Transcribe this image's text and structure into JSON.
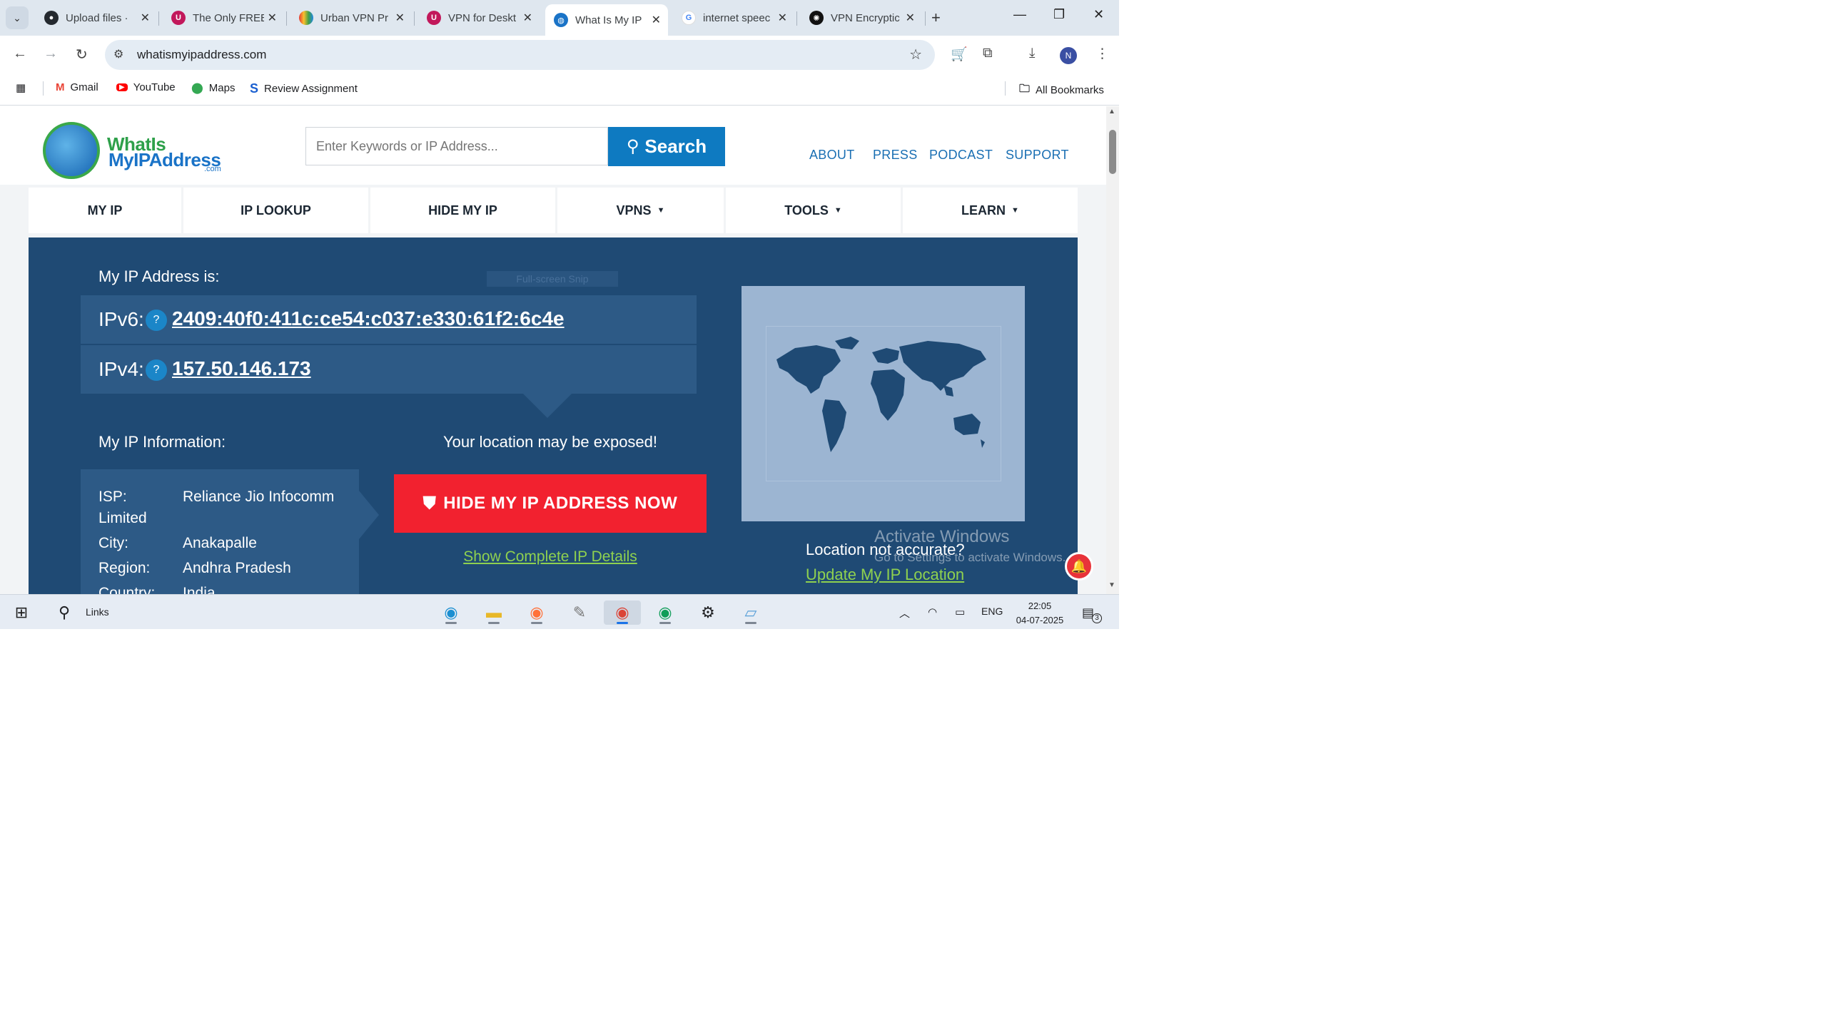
{
  "browser": {
    "tabs": [
      {
        "title": "Upload files · ",
        "icon": "github-icon"
      },
      {
        "title": "The Only FREE",
        "icon": "urban-vpn-icon"
      },
      {
        "title": "Urban VPN Pr",
        "icon": "rainbow-icon"
      },
      {
        "title": "VPN for Deskt",
        "icon": "urban-vpn-icon"
      },
      {
        "title": "What Is My IP",
        "icon": "globe-icon",
        "active": true
      },
      {
        "title": "internet speec",
        "icon": "google-icon"
      },
      {
        "title": "VPN Encryptic",
        "icon": "openai-icon"
      }
    ],
    "url": "whatismyipaddress.com",
    "profile_initial": "N",
    "bookmarks": [
      {
        "label": "Gmail",
        "icon": "gmail-icon"
      },
      {
        "label": "YouTube",
        "icon": "youtube-icon"
      },
      {
        "label": "Maps",
        "icon": "maps-icon"
      },
      {
        "label": "Review Assignment",
        "icon": "s-icon"
      }
    ],
    "all_bookmarks": "All Bookmarks"
  },
  "site": {
    "logo_line1": "WhatIs",
    "logo_line2": "MyIPAddress",
    "logo_com": ".com",
    "search_placeholder": "Enter Keywords or IP Address...",
    "search_button": "Search",
    "top_links": [
      "ABOUT",
      "PRESS",
      "PODCAST",
      "SUPPORT"
    ],
    "nav": [
      {
        "label": "MY IP",
        "caret": false
      },
      {
        "label": "IP LOOKUP",
        "caret": false
      },
      {
        "label": "HIDE MY IP",
        "caret": false
      },
      {
        "label": "VPNS",
        "caret": true
      },
      {
        "label": "TOOLS",
        "caret": true
      },
      {
        "label": "LEARN",
        "caret": true
      }
    ],
    "my_ip_label": "My IP Address is:",
    "snip_label": "Full-screen Snip",
    "ipv6_label": "IPv6:",
    "ipv6_value": "2409:40f0:411c:ce54:c037:e330:61f2:6c4e",
    "ipv4_label": "IPv4:",
    "ipv4_value": "157.50.146.173",
    "help_glyph": "?",
    "info_label": "My IP Information:",
    "info": [
      {
        "key": "ISP:",
        "value": "Reliance Jio Infocomm"
      },
      {
        "key": "Limited",
        "value": ""
      },
      {
        "key": "City:",
        "value": "Anakapalle"
      },
      {
        "key": "Region:",
        "value": "Andhra Pradesh"
      },
      {
        "key": "Country:",
        "value": "India"
      }
    ],
    "exposed_text": "Your location may be exposed!",
    "hide_button": "HIDE MY IP ADDRESS NOW",
    "show_details": "Show Complete IP Details",
    "location_q": "Location not accurate?",
    "update_location": "Update My IP Location",
    "watermark_title": "Activate Windows",
    "watermark_sub": "Go to Settings to activate Windows."
  },
  "taskbar": {
    "search_label": "Links",
    "lang": "ENG",
    "time": "22:05",
    "date": "04-07-2025",
    "notifications": "3"
  },
  "colors": {
    "hero_bg": "#1f4a74",
    "box_bg": "#2d5a86",
    "accent_blue": "#0e7ac1",
    "hide_red": "#f2212f",
    "link_green": "#8fd14f"
  }
}
